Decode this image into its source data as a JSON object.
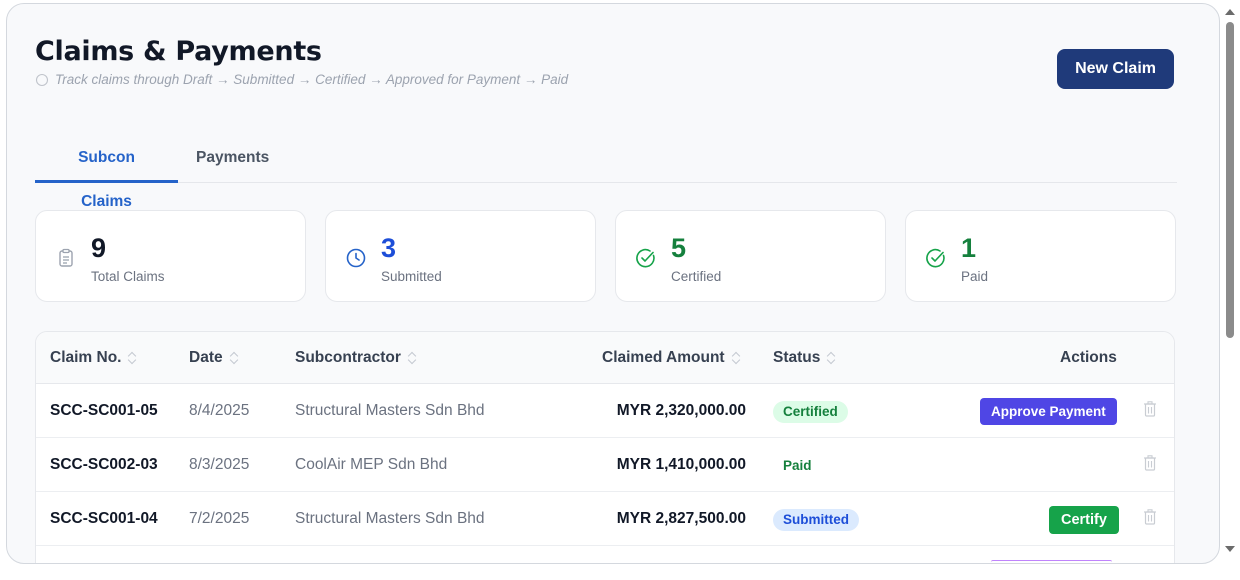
{
  "header": {
    "title": "Claims & Payments",
    "subtitle": "Track claims through Draft → Submitted → Certified → Approved for Payment → Paid",
    "new_claim_label": "New Claim"
  },
  "tabs": [
    {
      "label": "Subcon Claims",
      "active": true
    },
    {
      "label": "Payments",
      "active": false
    }
  ],
  "stats": [
    {
      "value": "9",
      "label": "Total Claims",
      "icon": "clipboard-icon",
      "color": "#111827"
    },
    {
      "value": "3",
      "label": "Submitted",
      "icon": "clock-icon",
      "color": "#1d4ed8"
    },
    {
      "value": "5",
      "label": "Certified",
      "icon": "check-circle-icon",
      "color": "#15803d"
    },
    {
      "value": "1",
      "label": "Paid",
      "icon": "check-circle-icon",
      "color": "#15803d"
    }
  ],
  "table": {
    "columns": [
      "Claim No.",
      "Date",
      "Subcontractor",
      "Claimed Amount",
      "Status",
      "Actions"
    ],
    "rows": [
      {
        "claim_no": "SCC-SC001-05",
        "date": "8/4/2025",
        "subcontractor": "Structural Masters Sdn Bhd",
        "amount": "MYR 2,320,000.00",
        "status": "Certified",
        "action": "Approve Payment"
      },
      {
        "claim_no": "SCC-SC002-03",
        "date": "8/3/2025",
        "subcontractor": "CoolAir MEP Sdn Bhd",
        "amount": "MYR 1,410,000.00",
        "status": "Paid",
        "action": ""
      },
      {
        "claim_no": "SCC-SC001-04",
        "date": "7/2/2025",
        "subcontractor": "Structural Masters Sdn Bhd",
        "amount": "MYR 2,827,500.00",
        "status": "Submitted",
        "action": "Certify"
      }
    ]
  },
  "colors": {
    "primary": "#1f3a7a",
    "tab_active": "#2563c9",
    "approve": "#4f46e5",
    "certify": "#16a34a"
  }
}
